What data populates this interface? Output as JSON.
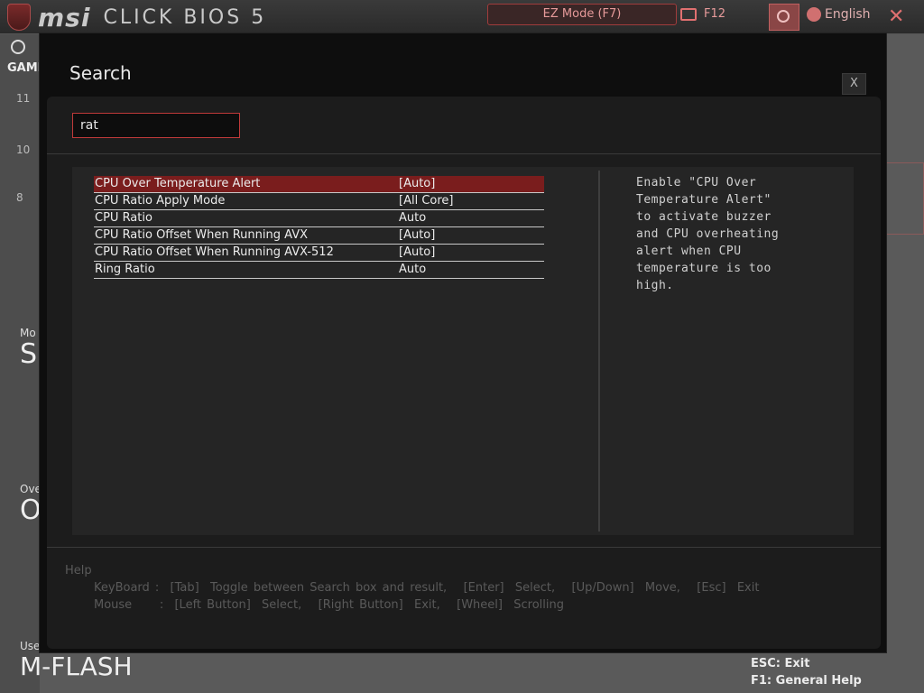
{
  "app": {
    "brand": "msi",
    "product": "CLICK BIOS 5",
    "ez_mode": "EZ Mode (F7)",
    "f12": "F12",
    "language": "English",
    "side_label": "GAME",
    "side_ticks": [
      "11",
      "10",
      "8"
    ],
    "bg_items": [
      {
        "small": "Mo",
        "big": "SI"
      },
      {
        "small": "Ove",
        "big": "O"
      }
    ],
    "usb_label": "Use",
    "mflash": "M-FLASH",
    "esc_hint": "ESC:  Exit",
    "f1_hint": "F1:  General  Help"
  },
  "modal": {
    "title": "Search",
    "close_label": "X",
    "search_value": "rat",
    "results": [
      {
        "name": "CPU Over Temperature Alert",
        "value": "[Auto]"
      },
      {
        "name": "CPU Ratio Apply Mode",
        "value": "[All Core]"
      },
      {
        "name": "CPU Ratio",
        "value": "Auto"
      },
      {
        "name": "CPU Ratio Offset When Running AVX",
        "value": "[Auto]"
      },
      {
        "name": "CPU Ratio Offset When Running AVX-512",
        "value": "[Auto]"
      },
      {
        "name": "Ring Ratio",
        "value": "Auto"
      }
    ],
    "selected_index": 0,
    "description": "Enable \"CPU Over Temperature Alert\" to activate buzzer and CPU overheating alert when CPU temperature is too high.",
    "help": {
      "title": "Help",
      "keyboard": "KeyBoard :  [Tab]  Toggle between Search box and result,   [Enter]  Select,   [Up/Down]  Move,   [Esc]  Exit",
      "mouse": "Mouse     :  [Left Button]  Select,   [Right Button]  Exit,   [Wheel]  Scrolling"
    }
  },
  "colors": {
    "accent_red": "#c03a3a",
    "selected_row": "#7a1d1d",
    "modal_bg": "#0e0e0e"
  }
}
